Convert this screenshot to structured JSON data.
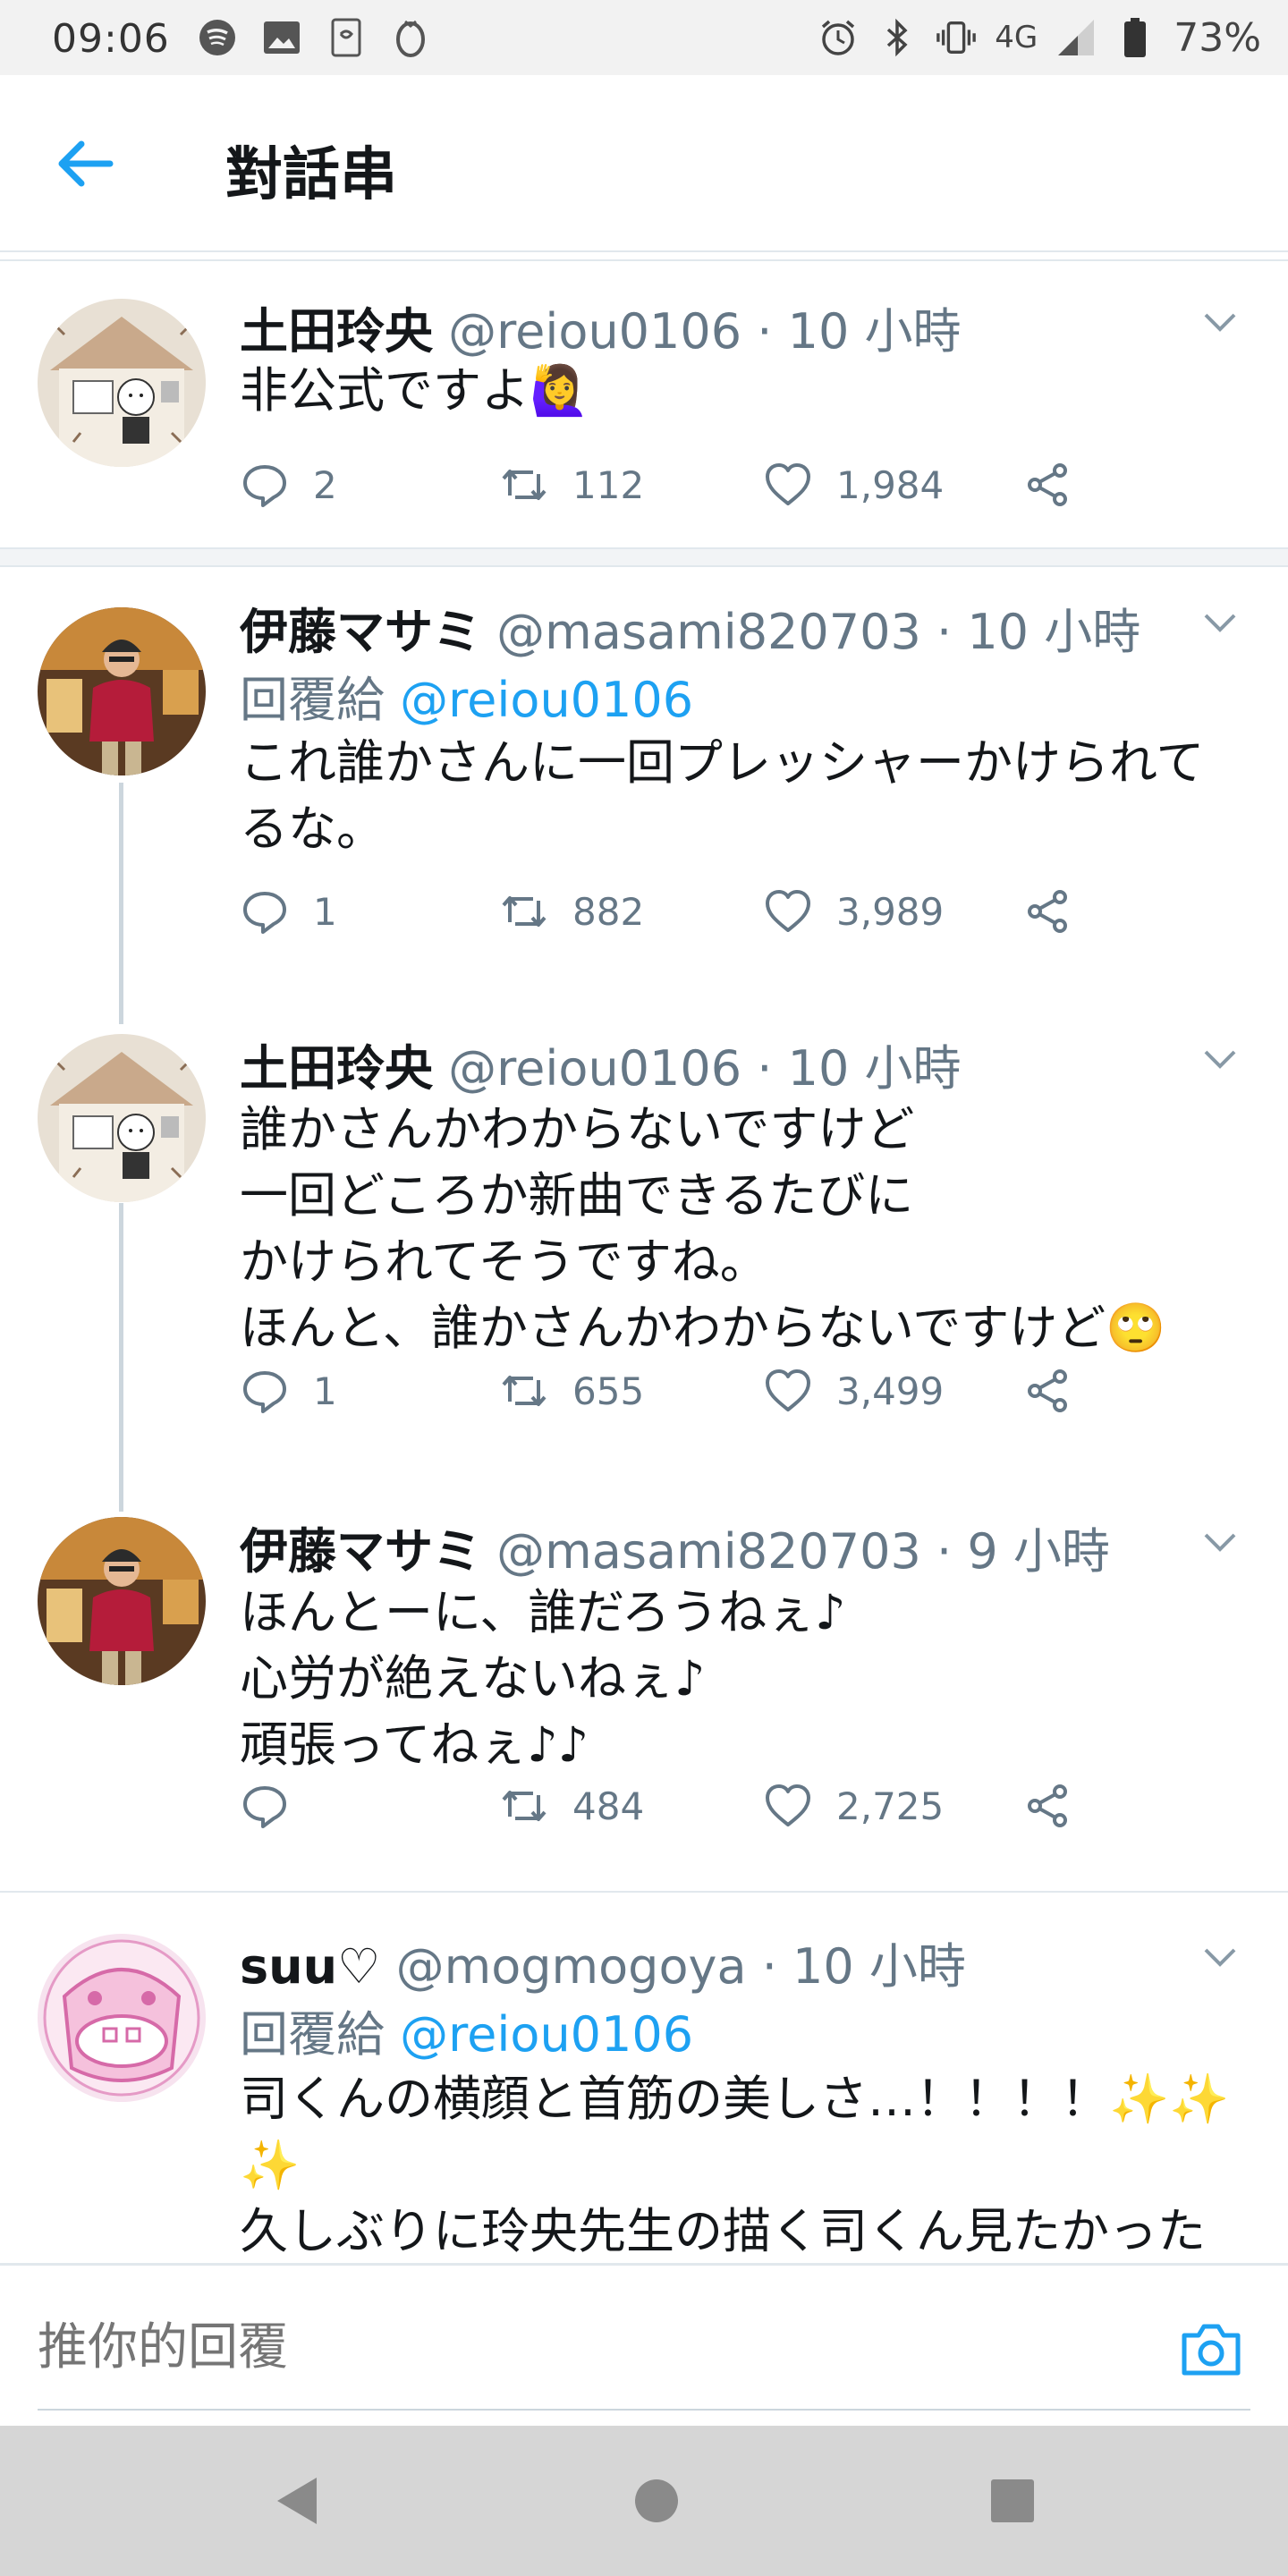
{
  "status_bar": {
    "time": "09:06",
    "network": "4G",
    "battery": "73%",
    "icons_left": [
      "spotify-icon",
      "gallery-icon",
      "notification-icon",
      "ring-icon"
    ],
    "icons_right": [
      "alarm-icon",
      "bluetooth-icon",
      "vibrate-icon",
      "signal-icon",
      "battery-icon"
    ]
  },
  "header": {
    "title": "對話串",
    "back_icon": "arrow-left-icon"
  },
  "tweets": [
    {
      "name": "土田玲央",
      "handle": "@reiou0106 · 10 小時",
      "text": [
        "非公式ですよ🙋‍♀️"
      ],
      "replies": "2",
      "retweets": "112",
      "likes": "1,984"
    },
    {
      "name": "伊藤マサミ",
      "handle": "@masami820703 · 10 小時",
      "reply_prefix": "回覆給",
      "reply_to": "@reiou0106",
      "text": [
        "これ誰かさんに一回プレッシャーかけられて",
        "るな。"
      ],
      "replies": "1",
      "retweets": "882",
      "likes": "3,989"
    },
    {
      "name": "土田玲央",
      "handle": "@reiou0106 · 10 小時",
      "text": [
        "誰かさんかわからないですけど",
        "一回どころか新曲できるたびに",
        "かけられてそうですね。",
        "ほんと、誰かさんかわからないですけど🙄"
      ],
      "replies": "1",
      "retweets": "655",
      "likes": "3,499"
    },
    {
      "name": "伊藤マサミ",
      "handle": "@masami820703 · 9 小時",
      "text": [
        "ほんとーに、誰だろうねぇ♪",
        "心労が絶えないねぇ♪",
        "頑張ってねぇ♪♪"
      ],
      "replies": "",
      "retweets": "484",
      "likes": "2,725"
    },
    {
      "name": "suu♡",
      "handle": "@mogmogoya · 10 小時",
      "reply_prefix": "回覆給",
      "reply_to": "@reiou0106",
      "text": [
        "司くんの横顔と首筋の美しさ…！！！！✨✨",
        "✨",
        "久しぶりに玲央先生の描く司くん見たかった"
      ]
    }
  ],
  "reply_bar": {
    "placeholder": "推你的回覆",
    "camera_icon": "camera-icon"
  },
  "nav_bar": {
    "buttons": [
      "back-triangle-icon",
      "home-circle-icon",
      "recents-square-icon"
    ]
  },
  "colors": {
    "accent": "#1da1f2",
    "text": "#14171a",
    "secondary": "#657786",
    "divider": "#e1e8ed"
  }
}
